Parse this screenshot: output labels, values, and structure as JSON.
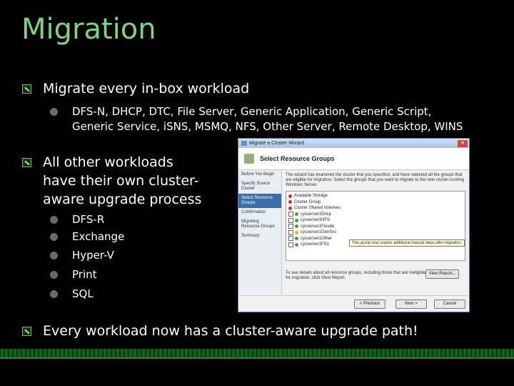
{
  "slide": {
    "title": "Migration",
    "bullets": {
      "b1": "Migrate every in-box workload",
      "b1_sub": "DFS-N, DHCP, DTC, File Server, Generic Application, Generic Script, Generic Service, iSNS, MSMQ, NFS, Other Server, Remote Desktop, WINS",
      "b2": "All other workloads have their own cluster-aware upgrade process",
      "b2_subs": [
        "DFS-R",
        "Exchange",
        "Hyper-V",
        "Print",
        "SQL"
      ],
      "b3": "Every workload now has a cluster-aware upgrade path!"
    }
  },
  "wizard": {
    "window_title": "Migrate a Cluster Wizard",
    "header": "Select Resource Groups",
    "nav": [
      "Before You Begin",
      "Specify Source Cluster",
      "Select Resource Groups",
      "Confirmation",
      "Migrating Resource Groups",
      "Summary"
    ],
    "description": "The wizard has examined the cluster that you specified, and have selected all the groups that are eligible for migration. Select the groups that you want to migrate to the new cluster running Windows Server.",
    "groups": [
      "Available Storage",
      "Cluster Group",
      "Cluster Shared Volumes",
      "cysserver1Dhcp",
      "cysserver1NFS",
      "cysserver1Ftsvde",
      "cysserver1GenSvc",
      "cysserver1Other",
      "cysserver1FS1"
    ],
    "tooltip": "This group may require additional manual steps after migration.",
    "footer_text": "To see details about all resource groups, including those that are ineligible for migration, click View Report.",
    "view_report": "View Report...",
    "previous": "< Previous",
    "next": "Next >",
    "cancel": "Cancel"
  },
  "colors": {
    "title_green": "#7fd37f",
    "background": "#000000",
    "accent_green": "#2a7f32"
  }
}
